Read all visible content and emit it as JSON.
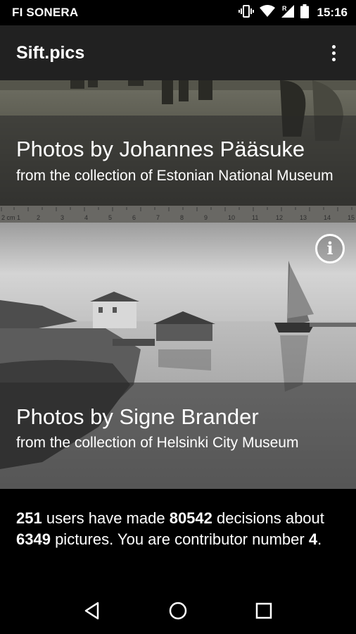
{
  "status_bar": {
    "carrier": "FI SONERA",
    "time": "15:16",
    "icons": [
      "vibrate-icon",
      "wifi-icon",
      "signal-roaming-icon",
      "battery-icon"
    ],
    "roaming_label": "R"
  },
  "app_bar": {
    "title": "Sift.pics",
    "menu_icon": "overflow-menu-icon"
  },
  "cards": [
    {
      "title": "Photos by Johannes Pääsuke",
      "subtitle": "from the collection of Estonian National Museum",
      "ruler_labels": [
        "2 cm 1",
        "2",
        "3",
        "4",
        "5",
        "6",
        "7",
        "8",
        "9",
        "10",
        "11",
        "12",
        "13",
        "14",
        "15"
      ]
    },
    {
      "title": "Photos by Signe Brander",
      "subtitle": "from the collection of Helsinki City Museum",
      "info_icon": "info-icon",
      "info_glyph": "i"
    }
  ],
  "stats": {
    "users": "251",
    "text_1": " users have made ",
    "decisions": "80542",
    "text_2": " decisions about ",
    "pictures": "6349",
    "text_3": " pictures. You are contributor number ",
    "contributor": "4",
    "text_4": "."
  },
  "nav_bar": {
    "buttons": [
      "back-icon",
      "home-icon",
      "recents-icon"
    ]
  },
  "colors": {
    "app_bar_bg": "#212121",
    "status_bar_bg": "#000000",
    "text": "#ffffff"
  }
}
